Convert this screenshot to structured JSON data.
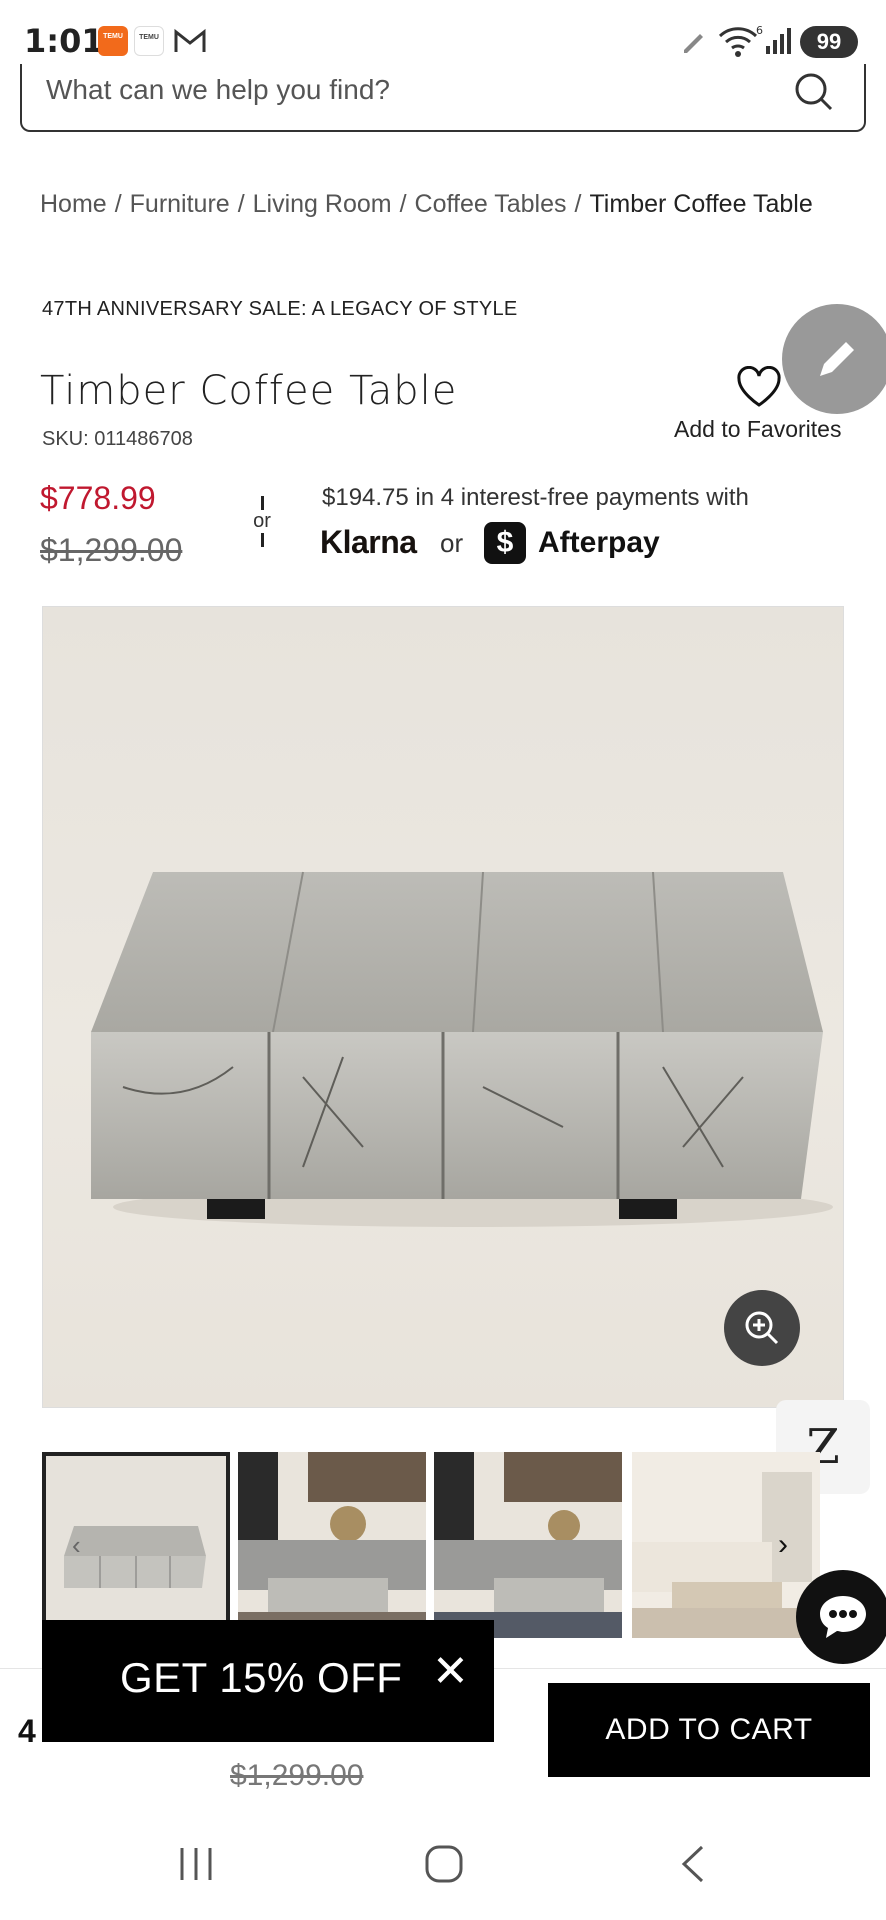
{
  "status_bar": {
    "time": "1:01",
    "battery": "99",
    "wifi_superscript": "6",
    "app_badges": [
      "TEMU",
      "TEMU"
    ]
  },
  "search": {
    "placeholder": "What can we help you find?"
  },
  "breadcrumb": {
    "items": [
      "Home",
      "Furniture",
      "Living Room",
      "Coffee Tables"
    ],
    "current": "Timber Coffee Table",
    "separator": "/"
  },
  "sale_banner": "47TH ANNIVERSARY SALE: A LEGACY OF STYLE",
  "product": {
    "title": "Timber Coffee Table",
    "sku": "SKU: 011486708",
    "price_sale": "$778.99",
    "price_original": "$1,299.00",
    "favorites_label": "Add to Favorites"
  },
  "payments": {
    "or_label": "or",
    "text": "$194.75 in 4 interest-free payments with",
    "klarna": "Klarna",
    "joiner": "or",
    "afterpay_glyph": "$",
    "afterpay": "Afterpay"
  },
  "floating": {
    "z_badge": "Z"
  },
  "gallery": {
    "thumb_count": 4,
    "prev_arrow": "‹",
    "next_arrow": "›"
  },
  "bottom_bar": {
    "partial_price": "4",
    "original_price": "$1,299.00",
    "add_to_cart": "ADD TO CART"
  },
  "promo": {
    "text": "GET 15% OFF",
    "close": "✕"
  },
  "colors": {
    "sale_red": "#c0182f",
    "black": "#000000"
  },
  "icons": [
    "search-icon",
    "heart-icon",
    "pencil-icon",
    "zoom-in-icon",
    "chat-icon",
    "gmail-icon",
    "wifi-icon",
    "signal-icon"
  ]
}
